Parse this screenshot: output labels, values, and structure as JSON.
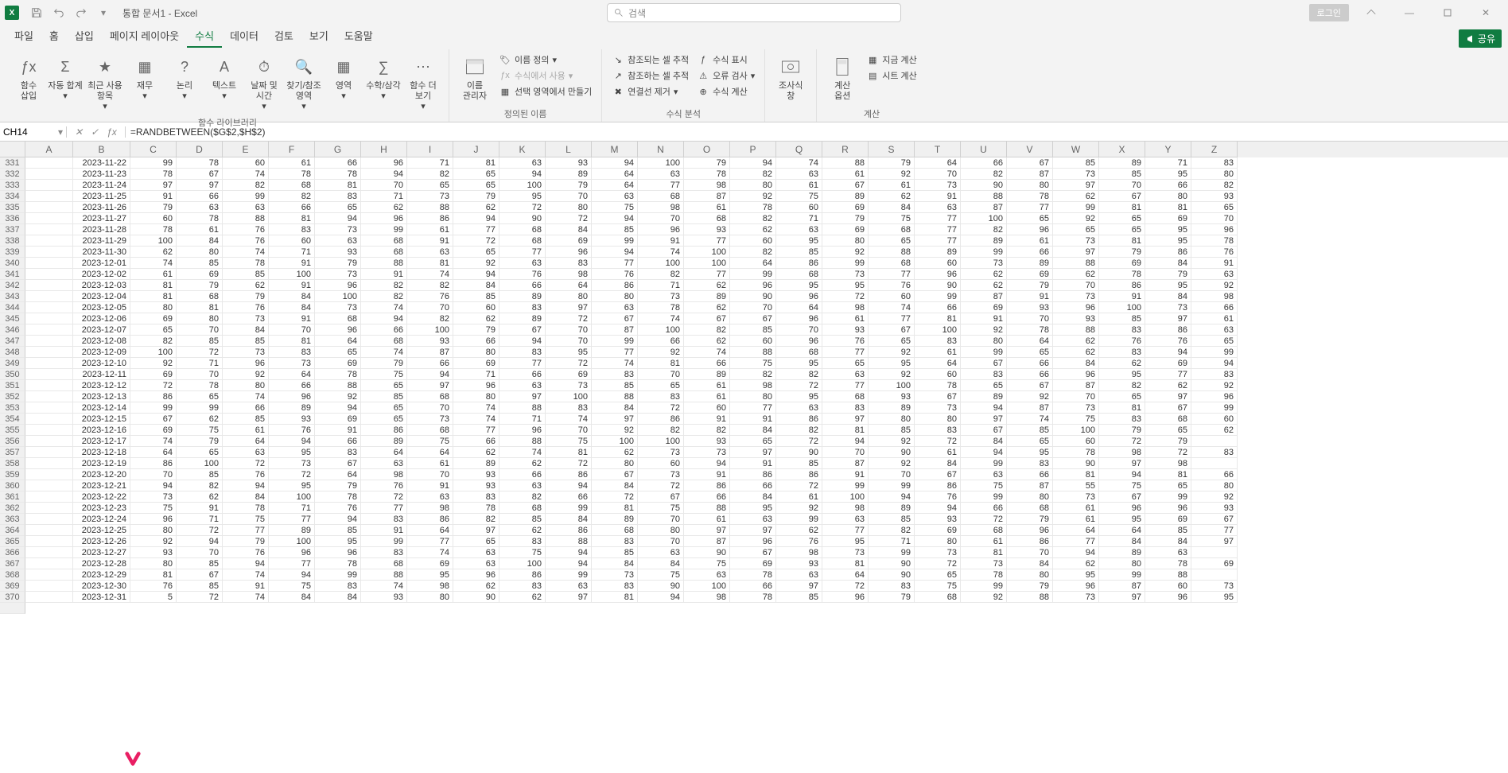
{
  "app": {
    "letter": "X",
    "title": "통합 문서1 - Excel"
  },
  "search": {
    "placeholder": "검색"
  },
  "titlebar": {
    "login": "로그인"
  },
  "tabs": {
    "items": [
      "파일",
      "홈",
      "삽입",
      "페이지 레이아웃",
      "수식",
      "데이터",
      "검토",
      "보기",
      "도움말"
    ],
    "active": 4,
    "share": "공유"
  },
  "ribbon": {
    "g1": {
      "label": "함수 라이브러리",
      "btns": [
        "함수\n삽입",
        "자동 합계",
        "최근 사용\n항목",
        "재무",
        "논리",
        "텍스트",
        "날짜 및\n시간",
        "찾기/참조\n영역",
        "영역",
        "수학/삼각",
        "함수 더\n보기"
      ]
    },
    "g2": {
      "label": "정의된 이름",
      "big": "이름\n관리자",
      "items": [
        "이름 정의",
        "수식에서 사용",
        "선택 영역에서 만들기"
      ]
    },
    "g3": {
      "label": "수식 분석",
      "left": [
        "참조되는 셀 추적",
        "참조하는 셀 추적",
        "연결선 제거"
      ],
      "right": [
        "수식 표시",
        "오류 검사",
        "수식 계산"
      ]
    },
    "g4a": "조사식\n창",
    "g4": {
      "label": "계산",
      "big": "계산\n옵션",
      "items": [
        "지금 계산",
        "시트 계산"
      ]
    }
  },
  "namebox": "CH14",
  "formula": "=RANDBETWEEN($G$2,$H$2)",
  "columns": [
    "A",
    "B",
    "C",
    "D",
    "E",
    "F",
    "G",
    "H",
    "I",
    "J",
    "K",
    "L",
    "M",
    "N",
    "O",
    "P",
    "Q",
    "R",
    "S",
    "T",
    "U",
    "V",
    "W",
    "X",
    "Y",
    "Z"
  ],
  "startRow": 331,
  "rows": [
    [
      "2023-11-22",
      99,
      78,
      60,
      61,
      66,
      96,
      71,
      81,
      63,
      93,
      94,
      100,
      79,
      94,
      74,
      88,
      79,
      64,
      66,
      67,
      85,
      89,
      71,
      83
    ],
    [
      "2023-11-23",
      78,
      67,
      74,
      78,
      78,
      94,
      82,
      65,
      94,
      89,
      64,
      63,
      78,
      82,
      63,
      61,
      92,
      70,
      82,
      87,
      73,
      85,
      95,
      80
    ],
    [
      "2023-11-24",
      97,
      97,
      82,
      68,
      81,
      70,
      65,
      65,
      100,
      79,
      64,
      77,
      98,
      80,
      61,
      67,
      61,
      73,
      90,
      80,
      97,
      70,
      66,
      82
    ],
    [
      "2023-11-25",
      91,
      66,
      99,
      82,
      83,
      71,
      73,
      79,
      95,
      70,
      63,
      68,
      87,
      92,
      75,
      89,
      62,
      91,
      88,
      78,
      62,
      67,
      80,
      93
    ],
    [
      "2023-11-26",
      79,
      63,
      63,
      66,
      65,
      62,
      88,
      62,
      72,
      80,
      75,
      98,
      61,
      78,
      60,
      69,
      84,
      63,
      87,
      77,
      99,
      81,
      81,
      65
    ],
    [
      "2023-11-27",
      60,
      78,
      88,
      81,
      94,
      96,
      86,
      94,
      90,
      72,
      94,
      70,
      68,
      82,
      71,
      79,
      75,
      77,
      100,
      65,
      92,
      65,
      69,
      70
    ],
    [
      "2023-11-28",
      78,
      61,
      76,
      83,
      73,
      99,
      61,
      77,
      68,
      84,
      85,
      96,
      93,
      62,
      63,
      69,
      68,
      77,
      82,
      96,
      65,
      65,
      95,
      96
    ],
    [
      "2023-11-29",
      100,
      84,
      76,
      60,
      63,
      68,
      91,
      72,
      68,
      69,
      99,
      91,
      77,
      60,
      95,
      80,
      65,
      77,
      89,
      61,
      73,
      81,
      95,
      78
    ],
    [
      "2023-11-30",
      62,
      80,
      74,
      71,
      93,
      68,
      63,
      65,
      77,
      96,
      94,
      74,
      100,
      82,
      85,
      92,
      88,
      89,
      99,
      66,
      97,
      79,
      86,
      76
    ],
    [
      "2023-12-01",
      74,
      85,
      78,
      91,
      79,
      88,
      81,
      92,
      63,
      83,
      77,
      100,
      100,
      64,
      86,
      99,
      68,
      60,
      73,
      89,
      88,
      69,
      84,
      91
    ],
    [
      "2023-12-02",
      61,
      69,
      85,
      100,
      73,
      91,
      74,
      94,
      76,
      98,
      76,
      82,
      77,
      99,
      68,
      73,
      77,
      96,
      62,
      69,
      62,
      78,
      79,
      63
    ],
    [
      "2023-12-03",
      81,
      79,
      62,
      91,
      96,
      82,
      82,
      84,
      66,
      64,
      86,
      71,
      62,
      96,
      95,
      95,
      76,
      90,
      62,
      79,
      70,
      86,
      95,
      92
    ],
    [
      "2023-12-04",
      81,
      68,
      79,
      84,
      100,
      82,
      76,
      85,
      89,
      80,
      80,
      73,
      89,
      90,
      96,
      72,
      60,
      99,
      87,
      91,
      73,
      91,
      84,
      98
    ],
    [
      "2023-12-05",
      80,
      81,
      76,
      84,
      73,
      74,
      70,
      60,
      83,
      97,
      63,
      78,
      62,
      70,
      64,
      98,
      74,
      66,
      69,
      93,
      96,
      100,
      73,
      66
    ],
    [
      "2023-12-06",
      69,
      80,
      73,
      91,
      68,
      94,
      82,
      62,
      89,
      72,
      67,
      74,
      67,
      67,
      96,
      61,
      77,
      81,
      91,
      70,
      93,
      85,
      97,
      61
    ],
    [
      "2023-12-07",
      65,
      70,
      84,
      70,
      96,
      66,
      100,
      79,
      67,
      70,
      87,
      100,
      82,
      85,
      70,
      93,
      67,
      100,
      92,
      78,
      88,
      83,
      86,
      63
    ],
    [
      "2023-12-08",
      82,
      85,
      85,
      81,
      64,
      68,
      93,
      66,
      94,
      70,
      99,
      66,
      62,
      60,
      96,
      76,
      65,
      83,
      80,
      64,
      62,
      76,
      76,
      65
    ],
    [
      "2023-12-09",
      100,
      72,
      73,
      83,
      65,
      74,
      87,
      80,
      83,
      95,
      77,
      92,
      74,
      88,
      68,
      77,
      92,
      61,
      99,
      65,
      62,
      83,
      94,
      99
    ],
    [
      "2023-12-10",
      92,
      71,
      96,
      73,
      69,
      79,
      66,
      69,
      77,
      72,
      74,
      81,
      66,
      75,
      95,
      65,
      95,
      64,
      67,
      66,
      84,
      62,
      69,
      94
    ],
    [
      "2023-12-11",
      69,
      70,
      92,
      64,
      78,
      75,
      94,
      71,
      66,
      69,
      83,
      70,
      89,
      82,
      82,
      63,
      92,
      60,
      83,
      66,
      96,
      95,
      77,
      83
    ],
    [
      "2023-12-12",
      72,
      78,
      80,
      66,
      88,
      65,
      97,
      96,
      63,
      73,
      85,
      65,
      61,
      98,
      72,
      77,
      100,
      78,
      65,
      67,
      87,
      82,
      62,
      92
    ],
    [
      "2023-12-13",
      86,
      65,
      74,
      96,
      92,
      85,
      68,
      80,
      97,
      100,
      88,
      83,
      61,
      80,
      95,
      68,
      93,
      67,
      89,
      92,
      70,
      65,
      97,
      96
    ],
    [
      "2023-12-14",
      99,
      99,
      66,
      89,
      94,
      65,
      70,
      74,
      88,
      83,
      84,
      72,
      60,
      77,
      63,
      83,
      89,
      73,
      94,
      87,
      73,
      81,
      67,
      99
    ],
    [
      "2023-12-15",
      67,
      62,
      85,
      93,
      69,
      65,
      73,
      74,
      71,
      74,
      97,
      86,
      91,
      91,
      86,
      97,
      80,
      80,
      97,
      74,
      75,
      83,
      68,
      60
    ],
    [
      "2023-12-16",
      69,
      75,
      61,
      76,
      91,
      86,
      68,
      77,
      96,
      70,
      92,
      82,
      82,
      84,
      82,
      81,
      85,
      83,
      67,
      85,
      100,
      79,
      65,
      62
    ],
    [
      "2023-12-17",
      74,
      79,
      64,
      94,
      66,
      89,
      75,
      66,
      88,
      75,
      100,
      100,
      93,
      65,
      72,
      94,
      92,
      72,
      84,
      65,
      60,
      72,
      79
    ],
    [
      "2023-12-18",
      64,
      65,
      63,
      95,
      83,
      64,
      64,
      62,
      74,
      81,
      62,
      73,
      73,
      97,
      90,
      70,
      90,
      61,
      94,
      95,
      78,
      98,
      72,
      83
    ],
    [
      "2023-12-19",
      86,
      100,
      72,
      73,
      67,
      63,
      61,
      89,
      62,
      72,
      80,
      60,
      94,
      91,
      85,
      87,
      92,
      84,
      99,
      83,
      90,
      97,
      98
    ],
    [
      "2023-12-20",
      70,
      85,
      76,
      72,
      64,
      98,
      70,
      93,
      66,
      86,
      67,
      73,
      91,
      86,
      86,
      91,
      70,
      67,
      63,
      66,
      81,
      94,
      81,
      66
    ],
    [
      "2023-12-21",
      94,
      82,
      94,
      95,
      79,
      76,
      91,
      93,
      63,
      94,
      84,
      72,
      86,
      66,
      72,
      99,
      99,
      86,
      75,
      87,
      55,
      75,
      65,
      80
    ],
    [
      "2023-12-22",
      73,
      62,
      84,
      100,
      78,
      72,
      63,
      83,
      82,
      66,
      72,
      67,
      66,
      84,
      61,
      100,
      94,
      76,
      99,
      80,
      73,
      67,
      99,
      92
    ],
    [
      "2023-12-23",
      75,
      91,
      78,
      71,
      76,
      77,
      98,
      78,
      68,
      99,
      81,
      75,
      88,
      95,
      92,
      98,
      89,
      94,
      66,
      68,
      61,
      96,
      96,
      93
    ],
    [
      "2023-12-24",
      96,
      71,
      75,
      77,
      94,
      83,
      86,
      82,
      85,
      84,
      89,
      70,
      61,
      63,
      99,
      63,
      85,
      93,
      72,
      79,
      61,
      95,
      69,
      67
    ],
    [
      "2023-12-25",
      80,
      72,
      77,
      89,
      85,
      91,
      64,
      97,
      62,
      86,
      68,
      80,
      97,
      97,
      62,
      77,
      82,
      69,
      68,
      96,
      64,
      64,
      85,
      77
    ],
    [
      "2023-12-26",
      92,
      94,
      79,
      100,
      95,
      99,
      77,
      65,
      83,
      88,
      83,
      70,
      87,
      96,
      76,
      95,
      71,
      80,
      61,
      86,
      77,
      84,
      84,
      97
    ],
    [
      "2023-12-27",
      93,
      70,
      76,
      96,
      96,
      83,
      74,
      63,
      75,
      94,
      85,
      63,
      90,
      67,
      98,
      73,
      99,
      73,
      81,
      70,
      94,
      89,
      63
    ],
    [
      "2023-12-28",
      80,
      85,
      94,
      77,
      78,
      68,
      69,
      63,
      100,
      94,
      84,
      84,
      75,
      69,
      93,
      81,
      90,
      72,
      73,
      84,
      62,
      80,
      78,
      69
    ],
    [
      "2023-12-29",
      81,
      67,
      74,
      94,
      99,
      88,
      95,
      96,
      86,
      99,
      73,
      75,
      63,
      78,
      63,
      64,
      90,
      65,
      78,
      80,
      95,
      99,
      88
    ],
    [
      "2023-12-30",
      76,
      85,
      91,
      75,
      83,
      74,
      98,
      62,
      83,
      63,
      83,
      90,
      100,
      66,
      97,
      72,
      83,
      75,
      99,
      79,
      96,
      87,
      60,
      73
    ],
    [
      "2023-12-31",
      "5",
      72,
      74,
      84,
      84,
      93,
      80,
      90,
      62,
      97,
      81,
      94,
      98,
      78,
      85,
      96,
      79,
      68,
      92,
      88,
      73,
      97,
      96,
      95
    ]
  ]
}
